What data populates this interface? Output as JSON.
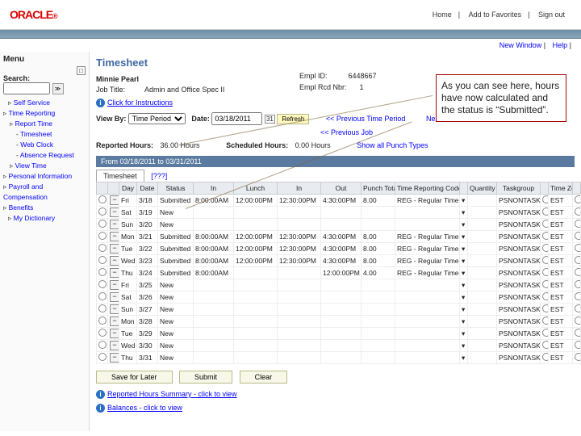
{
  "topbar": {
    "home": "Home",
    "fav": "Add to Favorites",
    "signout": "Sign out"
  },
  "util": {
    "newwin": "New Window",
    "help": "Help"
  },
  "nav": {
    "menu": "Menu",
    "items": [
      "Self Service",
      "Time Reporting",
      "Report Time",
      "Timesheet",
      "Web Clock",
      "Absence Request",
      "View Time",
      "Personal Information",
      "Payroll and Compensation",
      "Benefits",
      "My Dictionary"
    ]
  },
  "page": {
    "title": "Timesheet",
    "name": "Minnie Pearl",
    "job_lbl": "Job Title:",
    "job": "Admin and Office Spec II",
    "emp_lbl": "Empl ID:",
    "emp": "6448667",
    "rec_lbl": "Empl Rcd Nbr:",
    "rec": "1",
    "instr": "Click for Instructions"
  },
  "ctrl": {
    "view_lbl": "View By:",
    "view": "Time Period",
    "date_lbl": "Date:",
    "date": "03/18/2011",
    "refresh": "Refresh",
    "prev": "<< Previous Time Period",
    "next": "Next Time Period >>",
    "job": "<< Previous Job",
    "punch": "Show all Punch Types"
  },
  "rep": {
    "rh_lbl": "Reported Hours:",
    "rh": "36.00 Hours",
    "sh_lbl": "Scheduled Hours:",
    "sh": "0.00 Hours"
  },
  "range": "From 03/18/2011 to 03/31/2011",
  "tabs": {
    "t1": "Timesheet",
    "t2": "[???]"
  },
  "cols": [
    "",
    "",
    "Day",
    "Date",
    "Status",
    "In",
    "Lunch",
    "In",
    "Out",
    "Punch Total",
    "Time Reporting Code",
    "",
    "Quantity",
    "Taskgroup",
    "",
    "Time Zone",
    ""
  ],
  "rows": [
    {
      "day": "Fri",
      "date": "3/18",
      "status": "Submitted",
      "in1": "8:00:00AM",
      "lunch": "12:00:00PM",
      "in2": "12:30:00PM",
      "out": "4:30:00PM",
      "pt": "8.00",
      "trc": "REG - Regular Time",
      "tg": "PSNONTASK",
      "tz": "EST"
    },
    {
      "day": "Sat",
      "date": "3/19",
      "status": "New",
      "in1": "",
      "lunch": "",
      "in2": "",
      "out": "",
      "pt": "",
      "trc": "",
      "tg": "PSNONTASK",
      "tz": "EST"
    },
    {
      "day": "Sun",
      "date": "3/20",
      "status": "New",
      "in1": "",
      "lunch": "",
      "in2": "",
      "out": "",
      "pt": "",
      "trc": "",
      "tg": "PSNONTASK",
      "tz": "EST"
    },
    {
      "day": "Mon",
      "date": "3/21",
      "status": "Submitted",
      "in1": "8:00:00AM",
      "lunch": "12:00:00PM",
      "in2": "12:30:00PM",
      "out": "4:30:00PM",
      "pt": "8.00",
      "trc": "REG - Regular Time",
      "tg": "PSNONTASK",
      "tz": "EST"
    },
    {
      "day": "Tue",
      "date": "3/22",
      "status": "Submitted",
      "in1": "8:00:00AM",
      "lunch": "12:00:00PM",
      "in2": "12:30:00PM",
      "out": "4:30:00PM",
      "pt": "8.00",
      "trc": "REG - Regular Time",
      "tg": "PSNONTASK",
      "tz": "EST"
    },
    {
      "day": "Wed",
      "date": "3/23",
      "status": "Submitted",
      "in1": "8:00:00AM",
      "lunch": "12:00:00PM",
      "in2": "12:30:00PM",
      "out": "4:30:00PM",
      "pt": "8.00",
      "trc": "REG - Regular Time",
      "tg": "PSNONTASK",
      "tz": "EST"
    },
    {
      "day": "Thu",
      "date": "3/24",
      "status": "Submitted",
      "in1": "8:00:00AM",
      "lunch": "",
      "in2": "",
      "out": "12:00:00PM",
      "pt": "4.00",
      "trc": "REG - Regular Time",
      "tg": "PSNONTASK",
      "tz": "EST"
    },
    {
      "day": "Fri",
      "date": "3/25",
      "status": "New",
      "in1": "",
      "lunch": "",
      "in2": "",
      "out": "",
      "pt": "",
      "trc": "",
      "tg": "PSNONTASK",
      "tz": "EST"
    },
    {
      "day": "Sat",
      "date": "3/26",
      "status": "New",
      "in1": "",
      "lunch": "",
      "in2": "",
      "out": "",
      "pt": "",
      "trc": "",
      "tg": "PSNONTASK",
      "tz": "EST"
    },
    {
      "day": "Sun",
      "date": "3/27",
      "status": "New",
      "in1": "",
      "lunch": "",
      "in2": "",
      "out": "",
      "pt": "",
      "trc": "",
      "tg": "PSNONTASK",
      "tz": "EST"
    },
    {
      "day": "Mon",
      "date": "3/28",
      "status": "New",
      "in1": "",
      "lunch": "",
      "in2": "",
      "out": "",
      "pt": "",
      "trc": "",
      "tg": "PSNONTASK",
      "tz": "EST"
    },
    {
      "day": "Tue",
      "date": "3/29",
      "status": "New",
      "in1": "",
      "lunch": "",
      "in2": "",
      "out": "",
      "pt": "",
      "trc": "",
      "tg": "PSNONTASK",
      "tz": "EST"
    },
    {
      "day": "Wed",
      "date": "3/30",
      "status": "New",
      "in1": "",
      "lunch": "",
      "in2": "",
      "out": "",
      "pt": "",
      "trc": "",
      "tg": "PSNONTASK",
      "tz": "EST"
    },
    {
      "day": "Thu",
      "date": "3/31",
      "status": "New",
      "in1": "",
      "lunch": "",
      "in2": "",
      "out": "",
      "pt": "",
      "trc": "",
      "tg": "PSNONTASK",
      "tz": "EST"
    }
  ],
  "btns": {
    "save": "Save for Later",
    "submit": "Submit",
    "clear": "Clear"
  },
  "sum": {
    "hours": "Reported Hours Summary - click to view",
    "bal": "Balances - click to view"
  },
  "callout": "As you can see here, hours have now calculated and the status is “Submitted”."
}
